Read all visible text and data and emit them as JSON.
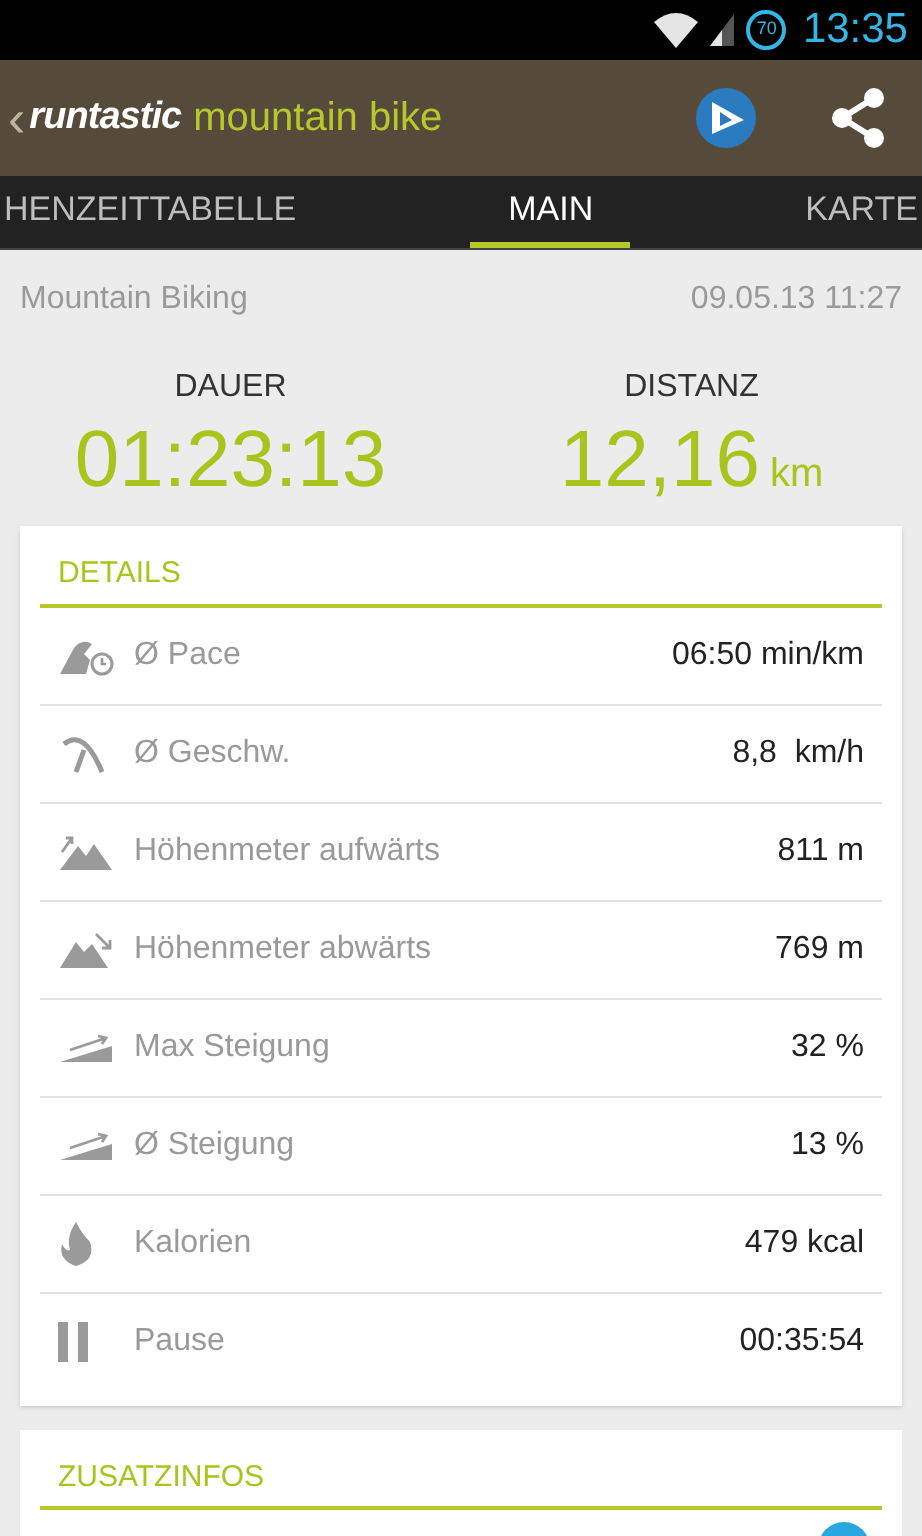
{
  "status_bar": {
    "battery": "70",
    "time": "13:35"
  },
  "app_bar": {
    "back": "‹",
    "brand": "runtastic",
    "product": "mountain bike"
  },
  "tabs": [
    {
      "label": "HENZEITTABELLE",
      "selected": false
    },
    {
      "label": "MAIN",
      "selected": true
    },
    {
      "label": "KARTE",
      "selected": false
    }
  ],
  "activity": {
    "type": "Mountain Biking",
    "date": "09.05.13 11:27"
  },
  "stats": [
    {
      "label": "DAUER",
      "value": "01:23:13"
    },
    {
      "label": "DISTANZ",
      "value": "12,16",
      "unit": "km"
    }
  ],
  "details": {
    "title": "DETAILS",
    "rows": [
      {
        "kind": "pace",
        "label": "Ø Pace",
        "value": "06:50 min/km"
      },
      {
        "kind": "speed",
        "label": "Ø Geschw.",
        "value": "8,8  km/h"
      },
      {
        "kind": "ascent",
        "label": "Höhenmeter aufwärts",
        "value": "811 m"
      },
      {
        "kind": "descent",
        "label": "Höhenmeter abwärts",
        "value": "769 m"
      },
      {
        "kind": "grade",
        "label": "Max Steigung",
        "value": "32 %"
      },
      {
        "kind": "grade",
        "label": "Ø Steigung",
        "value": "13 %"
      },
      {
        "kind": "calories",
        "label": "Kalorien",
        "value": "479 kcal"
      },
      {
        "kind": "pause",
        "label": "Pause",
        "value": "00:35:54"
      }
    ]
  },
  "extra": {
    "title": "ZUSATZINFOS"
  }
}
